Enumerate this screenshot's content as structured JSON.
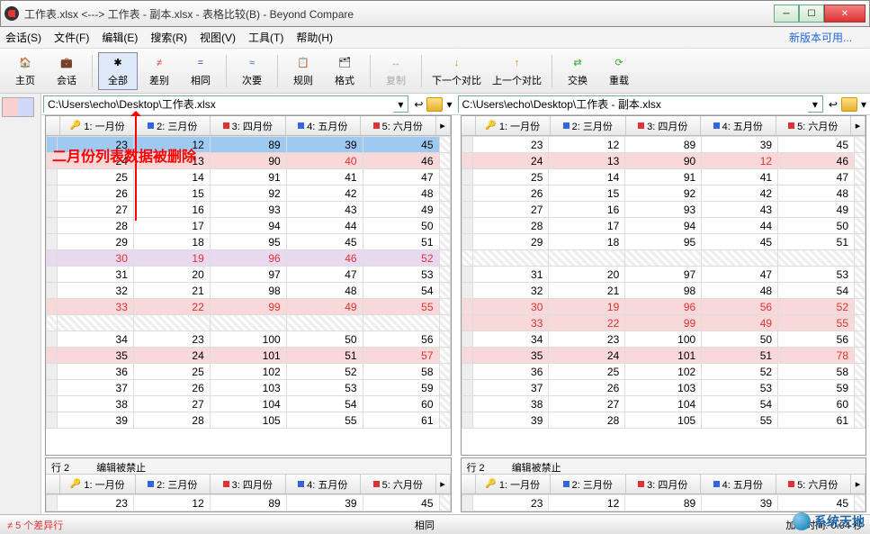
{
  "window": {
    "title": "工作表.xlsx <---> 工作表 - 副本.xlsx - 表格比较(B) - Beyond Compare"
  },
  "menu": {
    "session": "会话(S)",
    "file": "文件(F)",
    "edit": "编辑(E)",
    "search": "搜索(R)",
    "view": "视图(V)",
    "tools": "工具(T)",
    "help": "帮助(H)",
    "newver": "新版本可用..."
  },
  "toolbar": {
    "home": "主页",
    "session": "会话",
    "all": "全部",
    "diff": "差别",
    "same": "相同",
    "minor": "次要",
    "rules": "规则",
    "format": "格式",
    "copy": "复制",
    "next": "下一个对比",
    "prev": "上一个对比",
    "swap": "交换",
    "reload": "重载"
  },
  "paths": {
    "left": "C:\\Users\\echo\\Desktop\\工作表.xlsx",
    "right": "C:\\Users\\echo\\Desktop\\工作表 - 副本.xlsx"
  },
  "columns": [
    {
      "key": true,
      "sq": "none",
      "label": "1: 一月份"
    },
    {
      "key": false,
      "sq": "blue",
      "label": "2: 三月份"
    },
    {
      "key": false,
      "sq": "red",
      "label": "3: 四月份"
    },
    {
      "key": false,
      "sq": "blue",
      "label": "4: 五月份"
    },
    {
      "key": false,
      "sq": "red",
      "label": "5: 六月份"
    }
  ],
  "left_rows": [
    {
      "cls": "sel",
      "c": [
        23,
        12,
        89,
        39,
        45
      ]
    },
    {
      "cls": "diff",
      "c": [
        24,
        13,
        90,
        40,
        46
      ],
      "red": [
        3
      ]
    },
    {
      "cls": "",
      "c": [
        25,
        14,
        91,
        41,
        47
      ]
    },
    {
      "cls": "",
      "c": [
        26,
        15,
        92,
        42,
        48
      ]
    },
    {
      "cls": "",
      "c": [
        27,
        16,
        93,
        43,
        49
      ]
    },
    {
      "cls": "",
      "c": [
        28,
        17,
        94,
        44,
        50
      ]
    },
    {
      "cls": "",
      "c": [
        29,
        18,
        95,
        45,
        51
      ]
    },
    {
      "cls": "lav",
      "c": [
        30,
        19,
        96,
        46,
        52
      ],
      "red": [
        0,
        1,
        2,
        3,
        4
      ]
    },
    {
      "cls": "",
      "c": [
        31,
        20,
        97,
        47,
        53
      ]
    },
    {
      "cls": "",
      "c": [
        32,
        21,
        98,
        48,
        54
      ]
    },
    {
      "cls": "diff",
      "c": [
        33,
        22,
        99,
        49,
        55
      ],
      "red": [
        0,
        1,
        2,
        3,
        4
      ]
    },
    {
      "cls": "hatch",
      "c": [
        "",
        "",
        "",
        "",
        ""
      ]
    },
    {
      "cls": "",
      "c": [
        34,
        23,
        100,
        50,
        56
      ]
    },
    {
      "cls": "diff",
      "c": [
        35,
        24,
        101,
        51,
        57
      ],
      "red": [
        4
      ]
    },
    {
      "cls": "",
      "c": [
        36,
        25,
        102,
        52,
        58
      ]
    },
    {
      "cls": "",
      "c": [
        37,
        26,
        103,
        53,
        59
      ]
    },
    {
      "cls": "",
      "c": [
        38,
        27,
        104,
        54,
        60
      ]
    },
    {
      "cls": "",
      "c": [
        39,
        28,
        105,
        55,
        61
      ]
    }
  ],
  "right_rows": [
    {
      "cls": "",
      "c": [
        23,
        12,
        89,
        39,
        45
      ]
    },
    {
      "cls": "diff",
      "c": [
        24,
        13,
        90,
        12,
        46
      ],
      "red": [
        3
      ]
    },
    {
      "cls": "",
      "c": [
        25,
        14,
        91,
        41,
        47
      ]
    },
    {
      "cls": "",
      "c": [
        26,
        15,
        92,
        42,
        48
      ]
    },
    {
      "cls": "",
      "c": [
        27,
        16,
        93,
        43,
        49
      ]
    },
    {
      "cls": "",
      "c": [
        28,
        17,
        94,
        44,
        50
      ]
    },
    {
      "cls": "",
      "c": [
        29,
        18,
        95,
        45,
        51
      ]
    },
    {
      "cls": "hatch",
      "c": [
        "",
        "",
        "",
        "",
        ""
      ]
    },
    {
      "cls": "",
      "c": [
        31,
        20,
        97,
        47,
        53
      ]
    },
    {
      "cls": "",
      "c": [
        32,
        21,
        98,
        48,
        54
      ]
    },
    {
      "cls": "diff",
      "c": [
        30,
        19,
        96,
        56,
        52
      ],
      "red": [
        0,
        1,
        2,
        3,
        4
      ]
    },
    {
      "cls": "diff",
      "c": [
        33,
        22,
        99,
        49,
        55
      ],
      "red": [
        0,
        1,
        2,
        3,
        4
      ]
    },
    {
      "cls": "",
      "c": [
        34,
        23,
        100,
        50,
        56
      ]
    },
    {
      "cls": "diff",
      "c": [
        35,
        24,
        101,
        51,
        78
      ],
      "red": [
        4
      ]
    },
    {
      "cls": "",
      "c": [
        36,
        25,
        102,
        52,
        58
      ]
    },
    {
      "cls": "",
      "c": [
        37,
        26,
        103,
        53,
        59
      ]
    },
    {
      "cls": "",
      "c": [
        38,
        27,
        104,
        54,
        60
      ]
    },
    {
      "cls": "",
      "c": [
        39,
        28,
        105,
        55,
        61
      ]
    }
  ],
  "detail": {
    "row_label": "行 2",
    "locked": "编辑被禁止",
    "left_row": [
      23,
      12,
      89,
      39,
      45
    ],
    "right_row": [
      23,
      12,
      89,
      39,
      45
    ]
  },
  "status": {
    "diffcount": "≠  5 个差异行",
    "same": "相同",
    "loadtime": "加载时间:  0.04 秒"
  },
  "annotation": "二月份列表数据被删除",
  "watermark": "系统天地"
}
